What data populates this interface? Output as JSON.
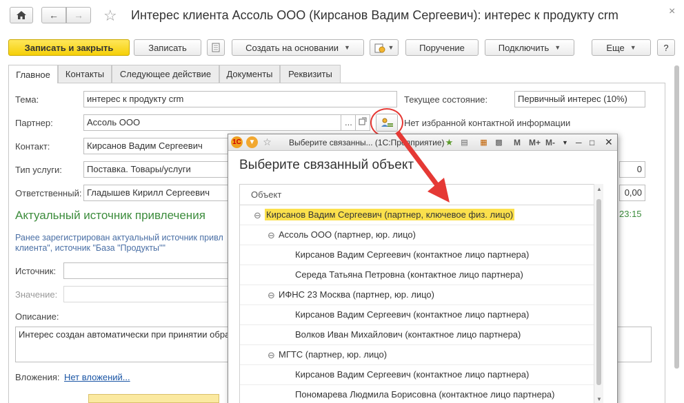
{
  "window": {
    "title": "Интерес клиента Ассоль ООО (Кирсанов Вадим Сергеевич): интерес к продукту crm",
    "close_glyph": "×"
  },
  "toolbar": {
    "save_close": "Записать и закрыть",
    "save": "Записать",
    "create_based": "Создать на основании",
    "assignment": "Поручение",
    "connect": "Подключить",
    "more": "Еще",
    "help": "?"
  },
  "tabs": [
    "Главное",
    "Контакты",
    "Следующее действие",
    "Документы",
    "Реквизиты"
  ],
  "form": {
    "topic_label": "Тема:",
    "topic_value": "интерес к продукту crm",
    "state_label": "Текущее состояние:",
    "state_value": "Первичный интерес (10%)",
    "partner_label": "Партнер:",
    "partner_value": "Ассоль ООО",
    "no_contact_info": "Нет избранной контактной информации",
    "contact_label": "Контакт:",
    "contact_value": "Кирсанов Вадим Сергеевич",
    "service_label": "Тип услуги:",
    "service_value": "Поставка. Товары/услуги",
    "responsible_label": "Ответственный:",
    "responsible_value": "Гладышев Кирилл Сергеевич",
    "right_value_1": "0",
    "right_value_2": "0,00",
    "right_time": "23:15",
    "source_section": "Актуальный источник привлечения",
    "source_note": "Ранее зарегистрирован актуальный источник привл клиента\", источник \"База \"Продукты\"\"",
    "source_label": "Источник:",
    "value_label": "Значение:",
    "description_label": "Описание:",
    "description_value": "Интерес создан автоматически при принятии обра",
    "attachments_label": "Вложения:",
    "attachments_link": "Нет вложений..."
  },
  "popup": {
    "title": "Выберите связанны... (1С:Предприятие)",
    "toolbar_icons": [
      "M",
      "M+",
      "M-"
    ],
    "heading": "Выберите связанный объект",
    "column_header": "Объект",
    "rows": [
      {
        "level": 0,
        "expander": "⊖",
        "text": "Кирсанов Вадим Сергеевич (партнер, ключевое физ. лицо)",
        "highlight": true
      },
      {
        "level": 1,
        "expander": "⊖",
        "text": "Ассоль ООО (партнер, юр. лицо)"
      },
      {
        "level": 2,
        "expander": "",
        "text": "Кирсанов Вадим Сергеевич (контактное лицо партнера)"
      },
      {
        "level": 2,
        "expander": "",
        "text": "Середа Татьяна Петровна (контактное лицо партнера)"
      },
      {
        "level": 1,
        "expander": "⊖",
        "text": "ИФНС 23 Москва (партнер, юр. лицо)"
      },
      {
        "level": 2,
        "expander": "",
        "text": "Кирсанов Вадим Сергеевич (контактное лицо партнера)"
      },
      {
        "level": 2,
        "expander": "",
        "text": "Волков Иван Михайлович (контактное лицо партнера)"
      },
      {
        "level": 1,
        "expander": "⊖",
        "text": "МГТС (партнер, юр. лицо)"
      },
      {
        "level": 2,
        "expander": "",
        "text": "Кирсанов Вадим Сергеевич (контактное лицо партнера)"
      },
      {
        "level": 2,
        "expander": "",
        "text": "Пономарева Людмила Борисовна (контактное лицо партнера)"
      }
    ]
  },
  "colors": {
    "accent_yellow": "#f5cf08",
    "highlight_yellow": "#fbe04c",
    "section_green": "#3c8c3c",
    "arrow_red": "#e53935"
  }
}
